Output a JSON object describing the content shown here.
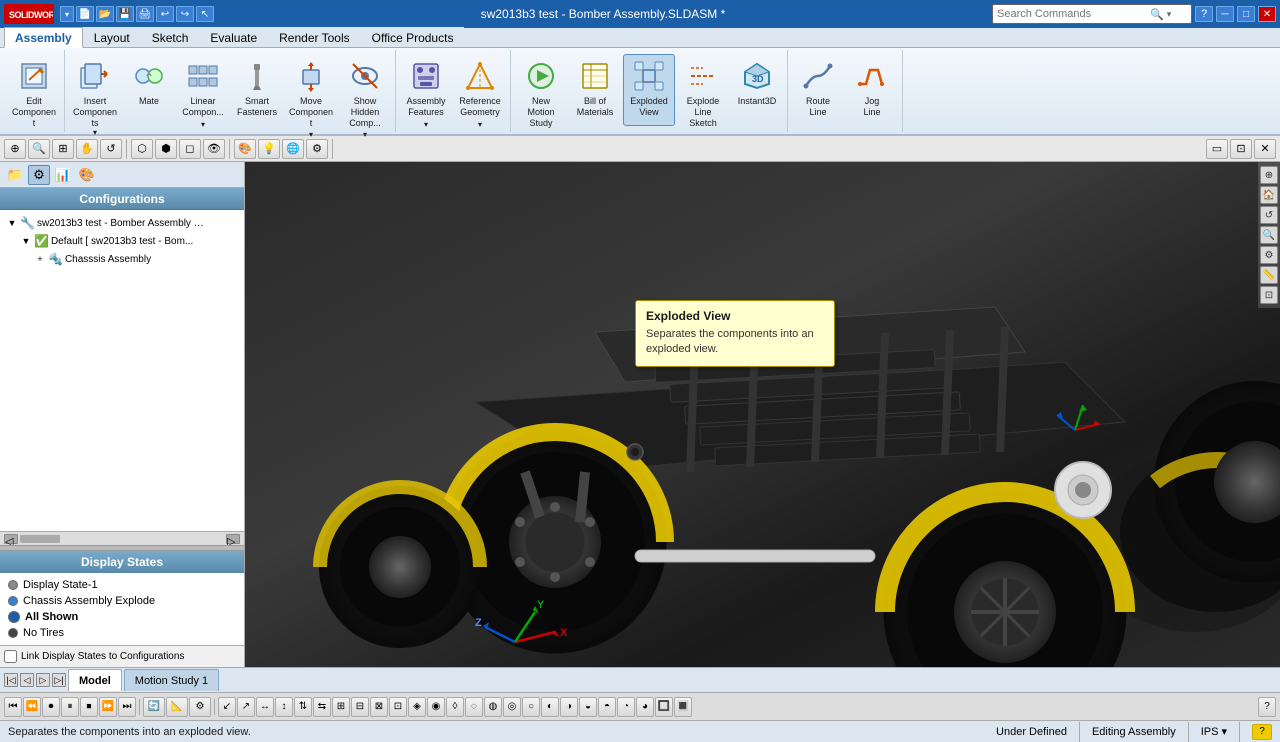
{
  "titlebar": {
    "logo": "SOLIDWORKS",
    "title": "sw2013b3 test - Bomber Assembly.SLDASM *",
    "search_placeholder": "Search Commands",
    "btn_min": "─",
    "btn_max": "□",
    "btn_close": "✕",
    "btn_help": "?"
  },
  "ribbon": {
    "tabs": [
      "Assembly",
      "Layout",
      "Sketch",
      "Evaluate",
      "Render Tools",
      "Office Products"
    ],
    "active_tab": "Assembly",
    "buttons": [
      {
        "id": "edit-component",
        "label": "Edit\nComponent",
        "icon": "✏️"
      },
      {
        "id": "insert-components",
        "label": "Insert\nComponents",
        "icon": "📦"
      },
      {
        "id": "mate",
        "label": "Mate",
        "icon": "🔗"
      },
      {
        "id": "linear-component",
        "label": "Linear\nCompon...",
        "icon": "⊞"
      },
      {
        "id": "smart-fasteners",
        "label": "Smart\nFasteners",
        "icon": "🔩"
      },
      {
        "id": "move-component",
        "label": "Move\nComponent",
        "icon": "↔"
      },
      {
        "id": "show-hidden",
        "label": "Show\nHidden\nComponents",
        "icon": "👁"
      },
      {
        "id": "assembly-features",
        "label": "Assembly\nFeatures",
        "icon": "⚙"
      },
      {
        "id": "reference-geometry",
        "label": "Reference\nGeometry",
        "icon": "📐"
      },
      {
        "id": "new-motion-study",
        "label": "New\nMotion\nStudy",
        "icon": "▶"
      },
      {
        "id": "bill-of-materials",
        "label": "Bill of\nMaterials",
        "icon": "📋"
      },
      {
        "id": "exploded-view",
        "label": "Exploded\nView",
        "icon": "💥"
      },
      {
        "id": "explode-line-sketch",
        "label": "Explode\nLine\nSketch",
        "icon": "📏"
      },
      {
        "id": "instant3d",
        "label": "Instant3D",
        "icon": "3️⃣"
      },
      {
        "id": "route-line",
        "label": "Route\nLine",
        "icon": "〰"
      },
      {
        "id": "jog-line",
        "label": "Jog\nLine",
        "icon": "⤵"
      }
    ]
  },
  "view_toolbar": {
    "buttons": [
      "🔍",
      "🔎",
      "👁",
      "🖱",
      "📷",
      "⬡",
      "⬢",
      "◯",
      "🎨",
      "🖊",
      "⚙"
    ]
  },
  "left_panel": {
    "icons": [
      "🗂",
      "📁",
      "📊",
      "🎨"
    ],
    "configurations_header": "Configurations",
    "tree": [
      {
        "id": "root",
        "label": "sw2013b3 test - Bomber Assembly C...",
        "indent": 0,
        "icon": "🔧",
        "expand": true
      },
      {
        "id": "default",
        "label": "Default [ sw2013b3 test - Bom...",
        "indent": 1,
        "icon": "✅",
        "expand": true
      },
      {
        "id": "chassis",
        "label": "Chasssis Assembly",
        "indent": 2,
        "icon": "🔩",
        "expand": false
      }
    ],
    "display_states_header": "Display States",
    "display_states": [
      {
        "id": "ds1",
        "label": "Display State-1",
        "dot": "gray"
      },
      {
        "id": "ds2",
        "label": "Chassis Assembly Explode",
        "dot": "blue"
      },
      {
        "id": "ds3",
        "label": "All Shown",
        "dot": "blue-filled"
      },
      {
        "id": "ds4",
        "label": "No Tires",
        "dot": "dark"
      }
    ],
    "link_label": "Link Display States to Configurations",
    "link_checked": false
  },
  "tooltip": {
    "title": "Exploded View",
    "body": "Separates the components into an exploded view."
  },
  "bottom_tabs": {
    "tabs": [
      "Model",
      "Motion Study 1"
    ],
    "active_tab": "Model"
  },
  "statusbar": {
    "left": "Separates the components into an exploded view.",
    "under_defined": "Under Defined",
    "editing": "Editing Assembly",
    "units": "IPS"
  }
}
